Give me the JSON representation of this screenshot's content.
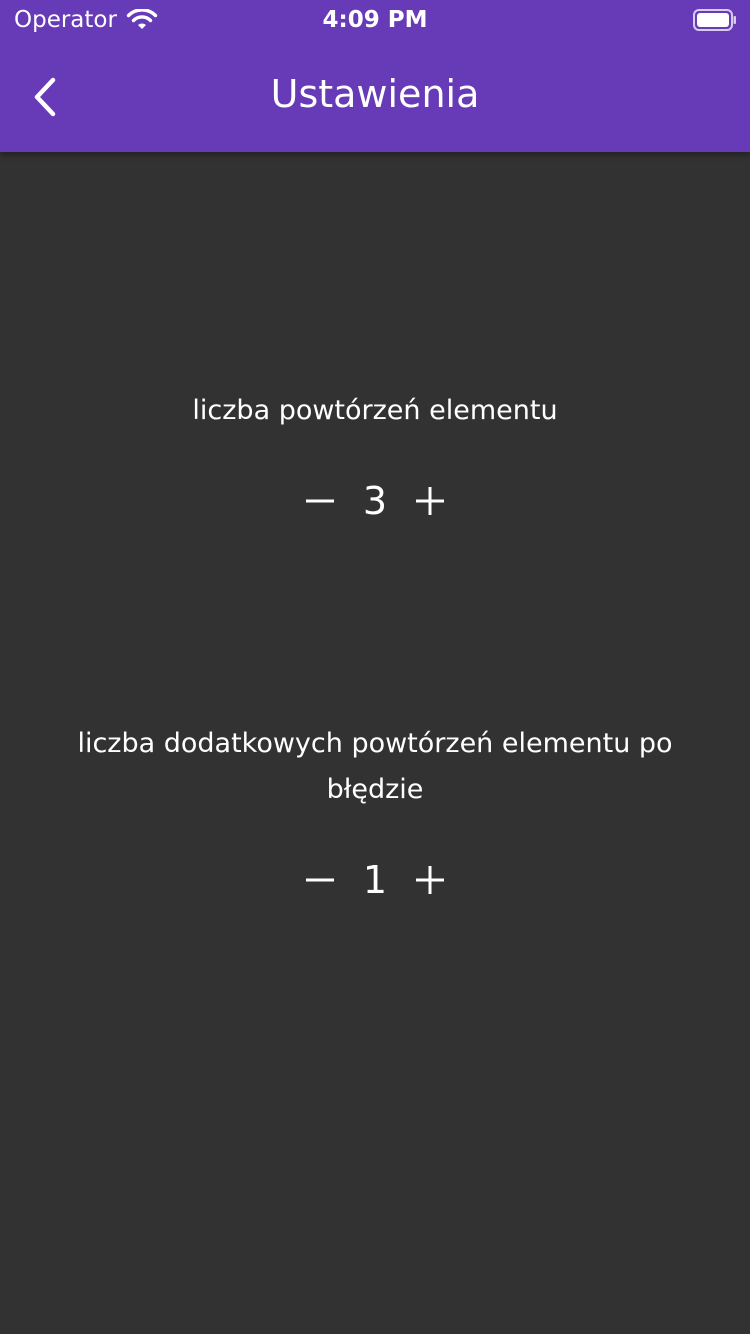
{
  "status_bar": {
    "carrier": "Operator",
    "time": "4:09 PM"
  },
  "header": {
    "title": "Ustawienia",
    "back_icon": "chevron-left-icon"
  },
  "settings": [
    {
      "label": "liczba powtórzeń elementu",
      "value": "3"
    },
    {
      "label": "liczba dodatkowych powtórzeń elementu po błędzie",
      "value": "1"
    }
  ],
  "colors": {
    "app_bar": "#673AB7",
    "background": "#323232",
    "text": "#FFFFFF"
  }
}
